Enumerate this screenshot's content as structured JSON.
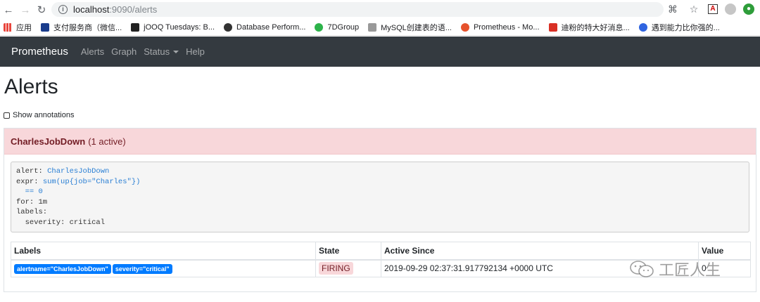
{
  "browser": {
    "url_host": "localhost",
    "url_path": ":9090/alerts"
  },
  "bookmarks": [
    {
      "label": "应用",
      "color": "#e8453c"
    },
    {
      "label": "支付服务商（微信...",
      "color": "#1a3c8c"
    },
    {
      "label": "jOOQ Tuesdays: B...",
      "color": "#222222"
    },
    {
      "label": "Database Perform...",
      "color": "#333333"
    },
    {
      "label": "7DGroup",
      "color": "#2db34a"
    },
    {
      "label": "MySQL创建表的语...",
      "color": "#666666"
    },
    {
      "label": "Prometheus - Mo...",
      "color": "#e6522c"
    },
    {
      "label": "迪粉的特大好消息...",
      "color": "#d93025"
    },
    {
      "label": "遇到能力比你强的...",
      "color": "#2f64e0"
    }
  ],
  "navbar": {
    "brand": "Prometheus",
    "links": [
      "Alerts",
      "Graph",
      "Status",
      "Help"
    ]
  },
  "page": {
    "title": "Alerts",
    "show_annotations": "Show annotations"
  },
  "alert_group": {
    "name": "CharlesJobDown",
    "count": "(1 active)",
    "rule": {
      "alert_key": "alert: ",
      "alert_val": "CharlesJobDown",
      "expr_key": "expr: ",
      "expr_val1": "sum(up{job=\"Charles\"})",
      "expr_val2": "  == 0",
      "for_line": "for: 1m",
      "labels_line": "labels:",
      "severity_line": "  severity: critical"
    },
    "table": {
      "headers": [
        "Labels",
        "State",
        "Active Since",
        "Value"
      ],
      "rows": [
        {
          "labels": [
            "alertname=\"CharlesJobDown\"",
            "severity=\"critical\""
          ],
          "state": "FIRING",
          "active_since": "2019-09-29 02:37:31.917792134 +0000 UTC",
          "value": "0"
        }
      ]
    }
  },
  "watermark": "工匠人生"
}
